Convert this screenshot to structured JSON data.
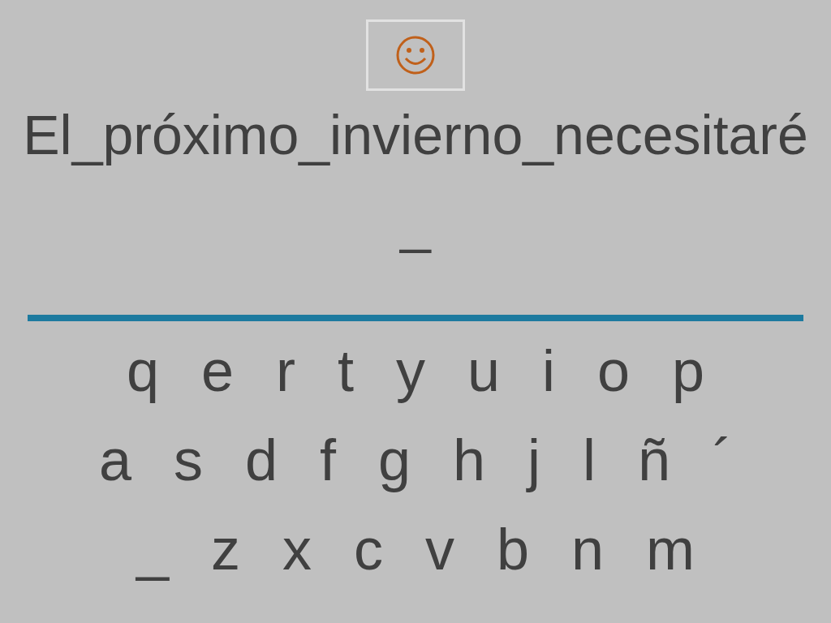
{
  "sentence_lines": [
    "El_próximo_invierno_necesitaré",
    "_"
  ],
  "keyboard_rows": [
    [
      "q",
      "e",
      "r",
      "t",
      "y",
      "u",
      "i",
      "o",
      "p"
    ],
    [
      "a",
      "s",
      "d",
      "f",
      "g",
      "h",
      "j",
      "l",
      "ñ",
      "´"
    ],
    [
      "_",
      "z",
      "x",
      "c",
      "v",
      "b",
      "n",
      "m"
    ]
  ]
}
